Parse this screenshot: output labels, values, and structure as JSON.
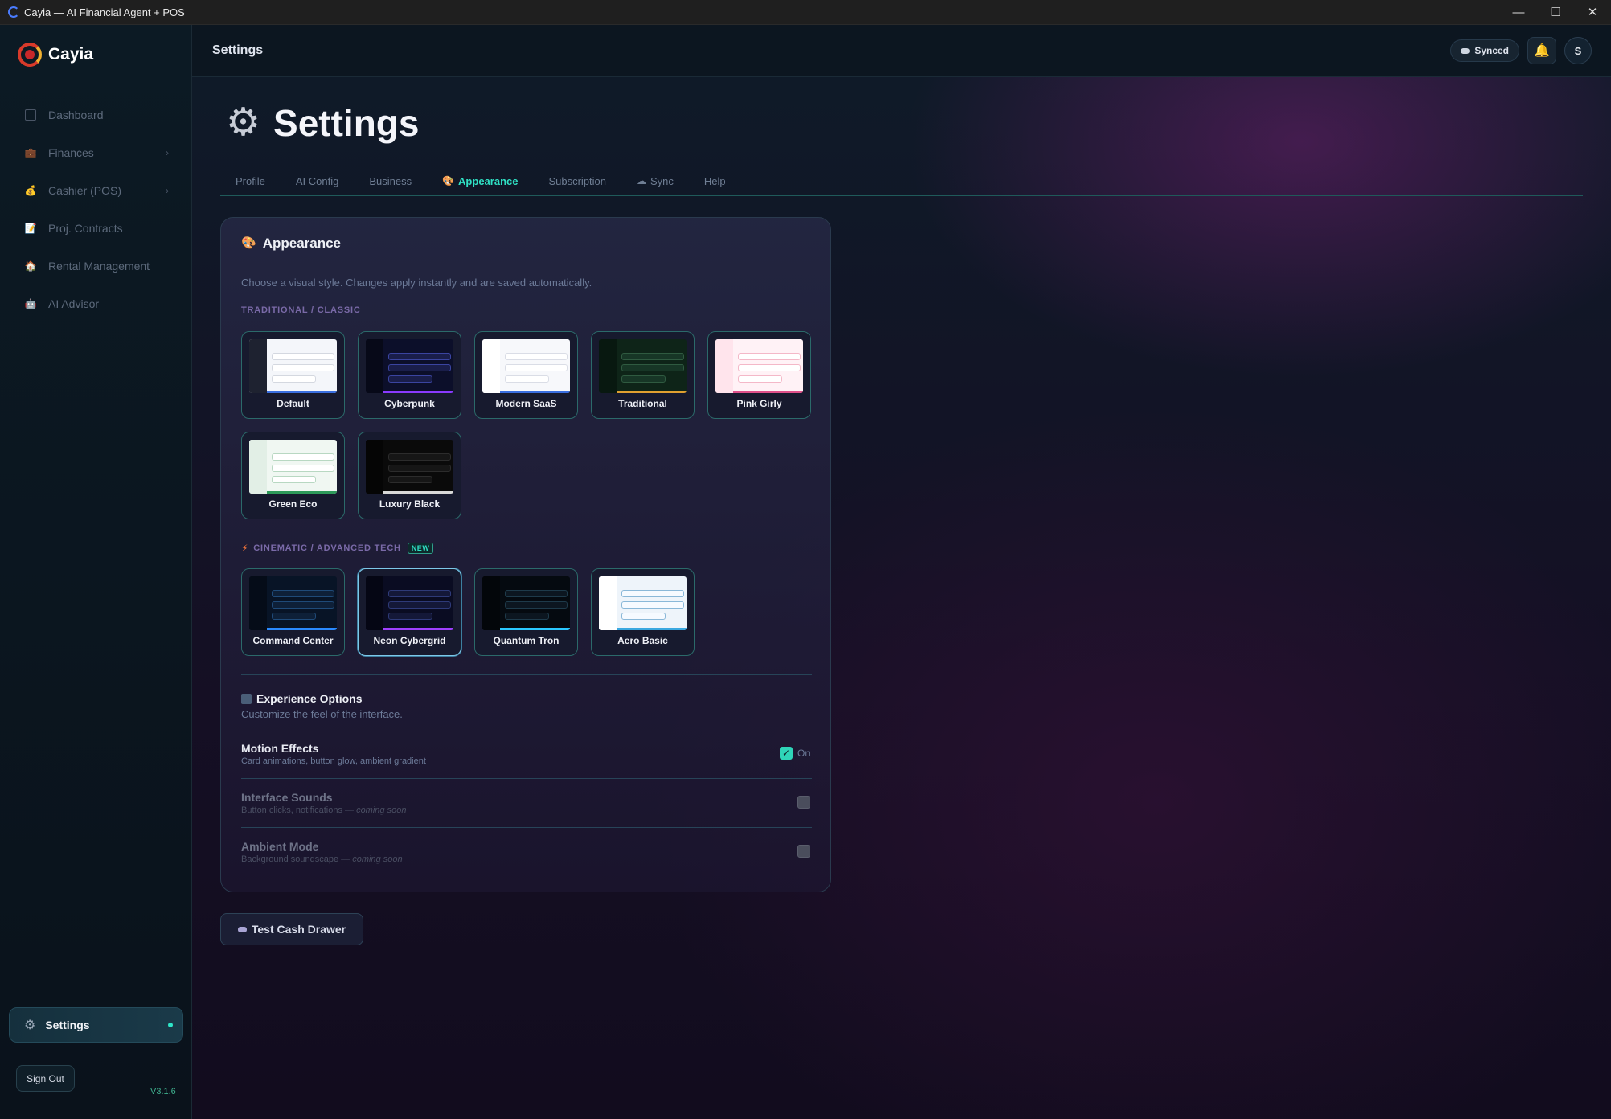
{
  "window": {
    "title": "Cayia — AI Financial Agent + POS",
    "controls": [
      "minimize",
      "maximize",
      "close"
    ]
  },
  "sidebar": {
    "brand": "Cayia",
    "items": [
      {
        "label": "Dashboard",
        "icon": "dashboard-icon",
        "has_submenu": false
      },
      {
        "label": "Finances",
        "icon": "briefcase-icon",
        "has_submenu": true
      },
      {
        "label": "Cashier (POS)",
        "icon": "money-bag-icon",
        "has_submenu": true
      },
      {
        "label": "Proj. Contracts",
        "icon": "document-icon",
        "has_submenu": false
      },
      {
        "label": "Rental Management",
        "icon": "house-icon",
        "has_submenu": false
      },
      {
        "label": "AI Advisor",
        "icon": "robot-icon",
        "has_submenu": false
      }
    ],
    "active_item": "Settings",
    "sign_out": "Sign Out",
    "version": "V3.1.6"
  },
  "topbar": {
    "title": "Settings",
    "sync_status": "Synced",
    "avatar_initial": "S"
  },
  "page": {
    "heading": "Settings",
    "tabs": [
      {
        "label": "Profile",
        "active": false
      },
      {
        "label": "AI Config",
        "active": false
      },
      {
        "label": "Business",
        "active": false
      },
      {
        "label": "Appearance",
        "active": true,
        "icon": "palette-icon"
      },
      {
        "label": "Subscription",
        "active": false
      },
      {
        "label": "Sync",
        "active": false,
        "icon": "cloud-icon"
      },
      {
        "label": "Help",
        "active": false
      }
    ]
  },
  "appearance": {
    "title": "Appearance",
    "description": "Choose a visual style. Changes apply instantly and are saved automatically.",
    "traditional_label": "TRADITIONAL / CLASSIC",
    "traditional_themes": [
      {
        "name": "Default",
        "bg": "#f4f6fa",
        "side": "#1e2230",
        "row": "#ffffff",
        "row_border": "#d4d8e0",
        "accent": "#3a6fe0"
      },
      {
        "name": "Cyberpunk",
        "bg": "#0c0f2a",
        "side": "#070918",
        "row": "#1a1e4a",
        "row_border": "#3a44a0",
        "accent": "#8a3aff"
      },
      {
        "name": "Modern SaaS",
        "bg": "#f7f8fb",
        "side": "#ffffff",
        "row": "#ffffff",
        "row_border": "#dadde6",
        "accent": "#3a6fe0"
      },
      {
        "name": "Traditional",
        "bg": "#0e2418",
        "side": "#081810",
        "row": "#173626",
        "row_border": "#2f5a40",
        "accent": "#e0a030"
      },
      {
        "name": "Pink Girly",
        "bg": "#fff2f6",
        "side": "#ffe4ec",
        "row": "#ffffff",
        "row_border": "#f4b8c8",
        "accent": "#e0508a"
      }
    ],
    "traditional_themes_row2": [
      {
        "name": "Green Eco",
        "bg": "#f0f7f2",
        "side": "#e2efe6",
        "row": "#ffffff",
        "row_border": "#b8d8c2",
        "accent": "#2e9a5a"
      },
      {
        "name": "Luxury Black",
        "bg": "#0a0a0a",
        "side": "#050505",
        "row": "#161616",
        "row_border": "#2c2c2c",
        "accent": "#d8d8d8"
      }
    ],
    "cinematic_label": "CINEMATIC / ADVANCED TECH",
    "new_badge": "NEW",
    "cinematic_themes": [
      {
        "name": "Command Center",
        "bg": "#081426",
        "side": "#050c18",
        "row": "#0e2038",
        "row_border": "#1f4a78",
        "accent": "#2a8aff",
        "selected": false
      },
      {
        "name": "Neon Cybergrid",
        "bg": "#0a0c22",
        "side": "#050614",
        "row": "#141838",
        "row_border": "#2e3a78",
        "accent": "#a040ff",
        "selected": true
      },
      {
        "name": "Quantum Tron",
        "bg": "#050a10",
        "side": "#03060a",
        "row": "#0c1620",
        "row_border": "#1e3a4a",
        "accent": "#2ac8ff",
        "selected": false
      },
      {
        "name": "Aero Basic",
        "bg": "#eef4fa",
        "side": "#ffffff",
        "row": "#f6faff",
        "row_border": "#8ab8d8",
        "accent": "#3aa8e0",
        "selected": false
      }
    ],
    "experience": {
      "title": "Experience Options",
      "subtitle": "Customize the feel of the interface.",
      "options": [
        {
          "title": "Motion Effects",
          "subtitle": "Card animations, button glow, ambient gradient",
          "coming_soon": "",
          "enabled": true,
          "state_label": "On"
        },
        {
          "title": "Interface Sounds",
          "subtitle": "Button clicks, notifications — ",
          "coming_soon": "coming soon",
          "enabled": false
        },
        {
          "title": "Ambient Mode",
          "subtitle": "Background soundscape — ",
          "coming_soon": "coming soon",
          "enabled": false
        }
      ]
    }
  },
  "actions": {
    "test_cash_drawer": "Test Cash Drawer"
  },
  "colors": {
    "accent": "#2fe0c4",
    "version_green": "#3fb08e",
    "bell": "#f5c518"
  }
}
